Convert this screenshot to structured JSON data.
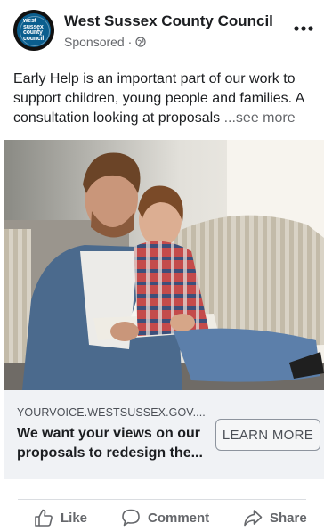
{
  "post": {
    "page_name": "West Sussex County Council",
    "sponsored_label": "Sponsored · ",
    "logo_words": [
      "west",
      "sussex",
      "county",
      "council"
    ],
    "text": "Early Help is an important part of our work to support children, young people and families. A consultation looking at proposals ",
    "see_more": "...see more"
  },
  "link_card": {
    "domain": "YOURVOICE.WESTSUSSEX.GOV....",
    "title": "We want your views on our proposals to redesign the...",
    "cta_label": "LEARN MORE"
  },
  "actions": {
    "like": "Like",
    "comment": "Comment",
    "share": "Share"
  },
  "colors": {
    "text": "#1c1e21",
    "secondary": "#65676b",
    "card_bg": "#f0f2f5",
    "logo_blue": "#0b5e8e"
  }
}
